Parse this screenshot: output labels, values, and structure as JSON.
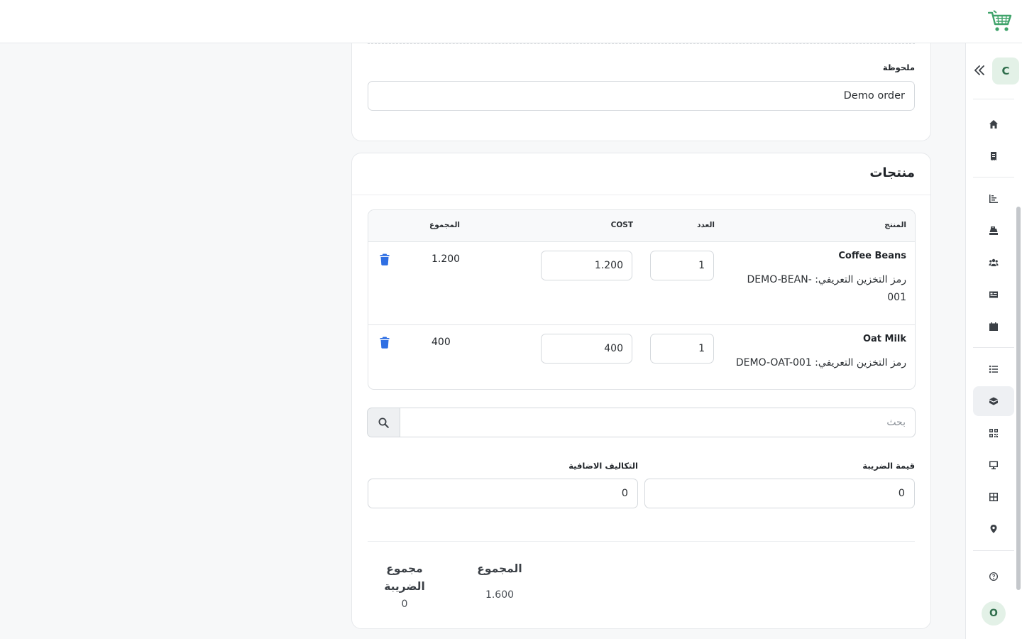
{
  "sidebar": {
    "org_initial": "C",
    "user_initial": "O",
    "items": [
      {
        "icon": "home-icon"
      },
      {
        "icon": "receipt-icon"
      },
      {
        "icon": "chart-icon"
      },
      {
        "icon": "register-icon"
      },
      {
        "icon": "users-icon"
      },
      {
        "icon": "id-card-icon"
      },
      {
        "icon": "calendar-icon"
      },
      {
        "icon": "list-icon"
      },
      {
        "icon": "box-icon",
        "active": true
      },
      {
        "icon": "qrcode-icon"
      },
      {
        "icon": "monitor-icon"
      },
      {
        "icon": "grid-icon"
      },
      {
        "icon": "location-icon"
      },
      {
        "icon": "help-icon"
      }
    ]
  },
  "note": {
    "label": "ملحوظة",
    "value": "Demo order"
  },
  "products": {
    "title": "منتجات",
    "columns": {
      "product": "المنتج",
      "qty": "العدد",
      "cost": "COST",
      "total": "المجموع"
    },
    "rows": [
      {
        "name": "Coffee Beans",
        "sku_line1": "رمز التخزين التعريفي: -DEMO-BEAN",
        "sku_line2": "001",
        "qty": "1",
        "cost": "1.200",
        "total": "1.200"
      },
      {
        "name": "Oat Milk",
        "sku_line1": "رمز التخزين التعريفي: DEMO-OAT-001",
        "sku_line2": "",
        "qty": "1",
        "cost": "400",
        "total": "400"
      }
    ],
    "search_placeholder": "بحث"
  },
  "tax": {
    "label": "قيمة الضريبة",
    "value": "0"
  },
  "extra_costs": {
    "label": "التكاليف الاضافية",
    "value": "0"
  },
  "summary": {
    "total_label": "المجموع",
    "total_value": "1.600",
    "tax_total_line1": "مجموع",
    "tax_total_line2": "الضريبة",
    "tax_total_value": "0"
  },
  "colors": {
    "accent_green": "#2f6e4c",
    "cart_green": "#3fa36a",
    "trash_blue": "#2f6fe3"
  }
}
